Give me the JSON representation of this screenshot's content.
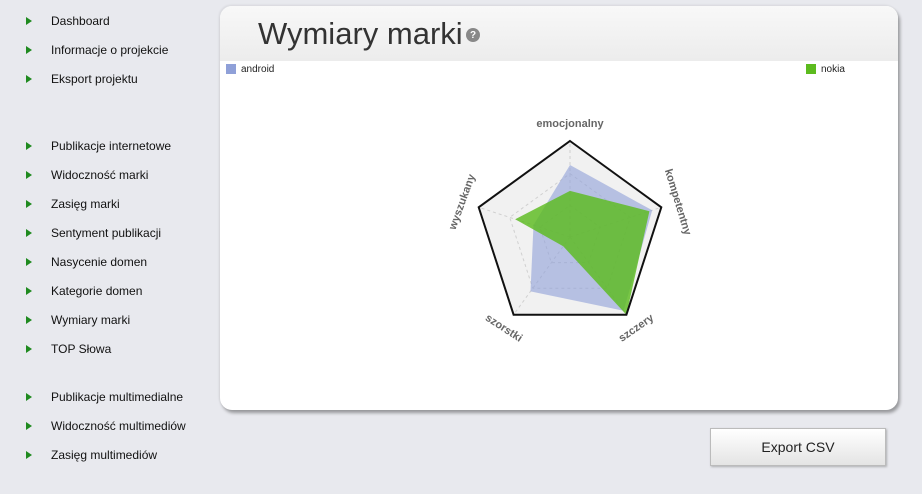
{
  "sidebar": {
    "items": [
      {
        "label": "Dashboard"
      },
      {
        "label": "Informacje o projekcie"
      },
      {
        "label": "Eksport projektu"
      },
      {
        "label": "Publikacje internetowe"
      },
      {
        "label": "Widoczność marki"
      },
      {
        "label": "Zasięg marki"
      },
      {
        "label": "Sentyment publikacji"
      },
      {
        "label": "Nasycenie domen"
      },
      {
        "label": "Kategorie domen"
      },
      {
        "label": "Wymiary marki"
      },
      {
        "label": "TOP Słowa"
      },
      {
        "label": "Publikacje multimedialne"
      },
      {
        "label": "Widoczność multimediów"
      },
      {
        "label": "Zasięg multimediów"
      }
    ]
  },
  "panel": {
    "title": "Wymiary marki",
    "help_icon": "question-mark-icon"
  },
  "legend": {
    "android": "android",
    "nokia": "nokia"
  },
  "colors": {
    "android": "#8fa0d8",
    "nokia": "#5cbb1e",
    "nav_arrow": "#1f8a1f"
  },
  "export_button": "Export CSV",
  "chart_data": {
    "type": "radar",
    "axes": [
      "emocjonalny",
      "kompetentny",
      "szczery",
      "szorstki",
      "wyszukany"
    ],
    "range": [
      0,
      1
    ],
    "grid": true,
    "legend_placement": "top",
    "series": [
      {
        "name": "android",
        "values": [
          0.75,
          0.9,
          0.95,
          0.7,
          0.4
        ]
      },
      {
        "name": "nokia",
        "values": [
          0.48,
          0.87,
          1.0,
          0.12,
          0.6
        ]
      }
    ]
  }
}
